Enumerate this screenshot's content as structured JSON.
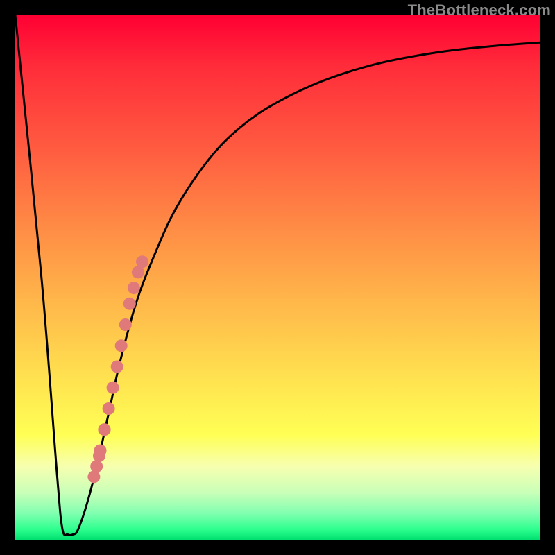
{
  "watermark": {
    "text": "TheBottleneck.com"
  },
  "colors": {
    "curve_stroke": "#000000",
    "marker_fill": "#e07a7a",
    "marker_stroke": "#c55b5b"
  },
  "chart_data": {
    "type": "line",
    "title": "",
    "xlabel": "",
    "ylabel": "",
    "xlim": [
      0,
      100
    ],
    "ylim": [
      0,
      100
    ],
    "grid": false,
    "legend": false,
    "series": [
      {
        "name": "bottleneck-curve",
        "x": [
          0,
          5,
          8,
          9,
          10,
          11,
          12,
          14,
          16,
          18,
          20,
          23,
          26,
          30,
          35,
          40,
          46,
          53,
          60,
          68,
          76,
          84,
          92,
          100
        ],
        "y": [
          100,
          50,
          12,
          2,
          1,
          1,
          2,
          8,
          16,
          25,
          34,
          45,
          53,
          62,
          70,
          76,
          81,
          85,
          88,
          90.5,
          92.2,
          93.4,
          94.2,
          94.8
        ]
      }
    ],
    "markers": {
      "name": "highlighted-points",
      "x": [
        15.5,
        16.2,
        17.0,
        17.8,
        18.6,
        19.4,
        20.2,
        21.0,
        21.8,
        22.6,
        23.4,
        24.2,
        17.0,
        16.0,
        15.0
      ],
      "y": [
        14,
        17,
        21,
        25,
        29,
        33,
        37,
        41,
        45,
        48,
        51,
        53,
        21,
        16,
        12
      ]
    }
  }
}
